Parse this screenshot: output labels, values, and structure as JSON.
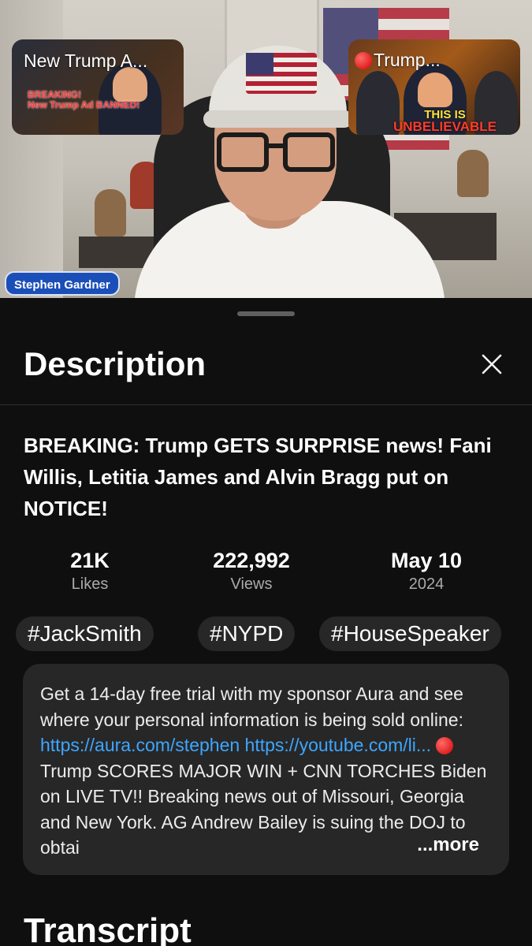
{
  "video": {
    "presenter_name": "Stephen Gardner",
    "overlay_left": {
      "title": "New Trump A...",
      "caption_line1": "BREAKING!",
      "caption_line2": "New Trump Ad BANNED!"
    },
    "overlay_right": {
      "title": "Trump...",
      "badge_line1": "THIS IS",
      "badge_line2": "UNBELIEVABLE"
    }
  },
  "sheet": {
    "title": "Description",
    "close_icon": "close-icon",
    "video_title": "BREAKING: Trump GETS SURPRISE news! Fani Willis, Letitia James and Alvin Bragg put on NOTICE!",
    "stats": [
      {
        "value": "21K",
        "label": "Likes"
      },
      {
        "value": "222,992",
        "label": "Views"
      },
      {
        "value": "May 10",
        "label": "2024"
      }
    ],
    "hashtags": [
      "#JackSmith",
      "#NYPD",
      "#HouseSpeaker"
    ],
    "description": {
      "text_before_link": "Get a 14-day free trial with my sponsor Aura and see where your personal information is being sold online: ",
      "link1": "https://aura.com/stephen",
      "link2": "https://youtube.com/li...",
      "text_after_links": " Trump SCORES MAJOR WIN + CNN TORCHES Biden on LIVE TV!!  Breaking news out of Missouri, Georgia and New York. AG Andrew Bailey is suing the DOJ to obtai",
      "more_label": "...more"
    },
    "transcript_heading": "Transcript"
  },
  "colors": {
    "background": "#0f0f0f",
    "chip_background": "#272727",
    "link": "#3ea6ff",
    "name_chip": "#1b4fb8",
    "secondary_text": "#aaaaaa"
  }
}
